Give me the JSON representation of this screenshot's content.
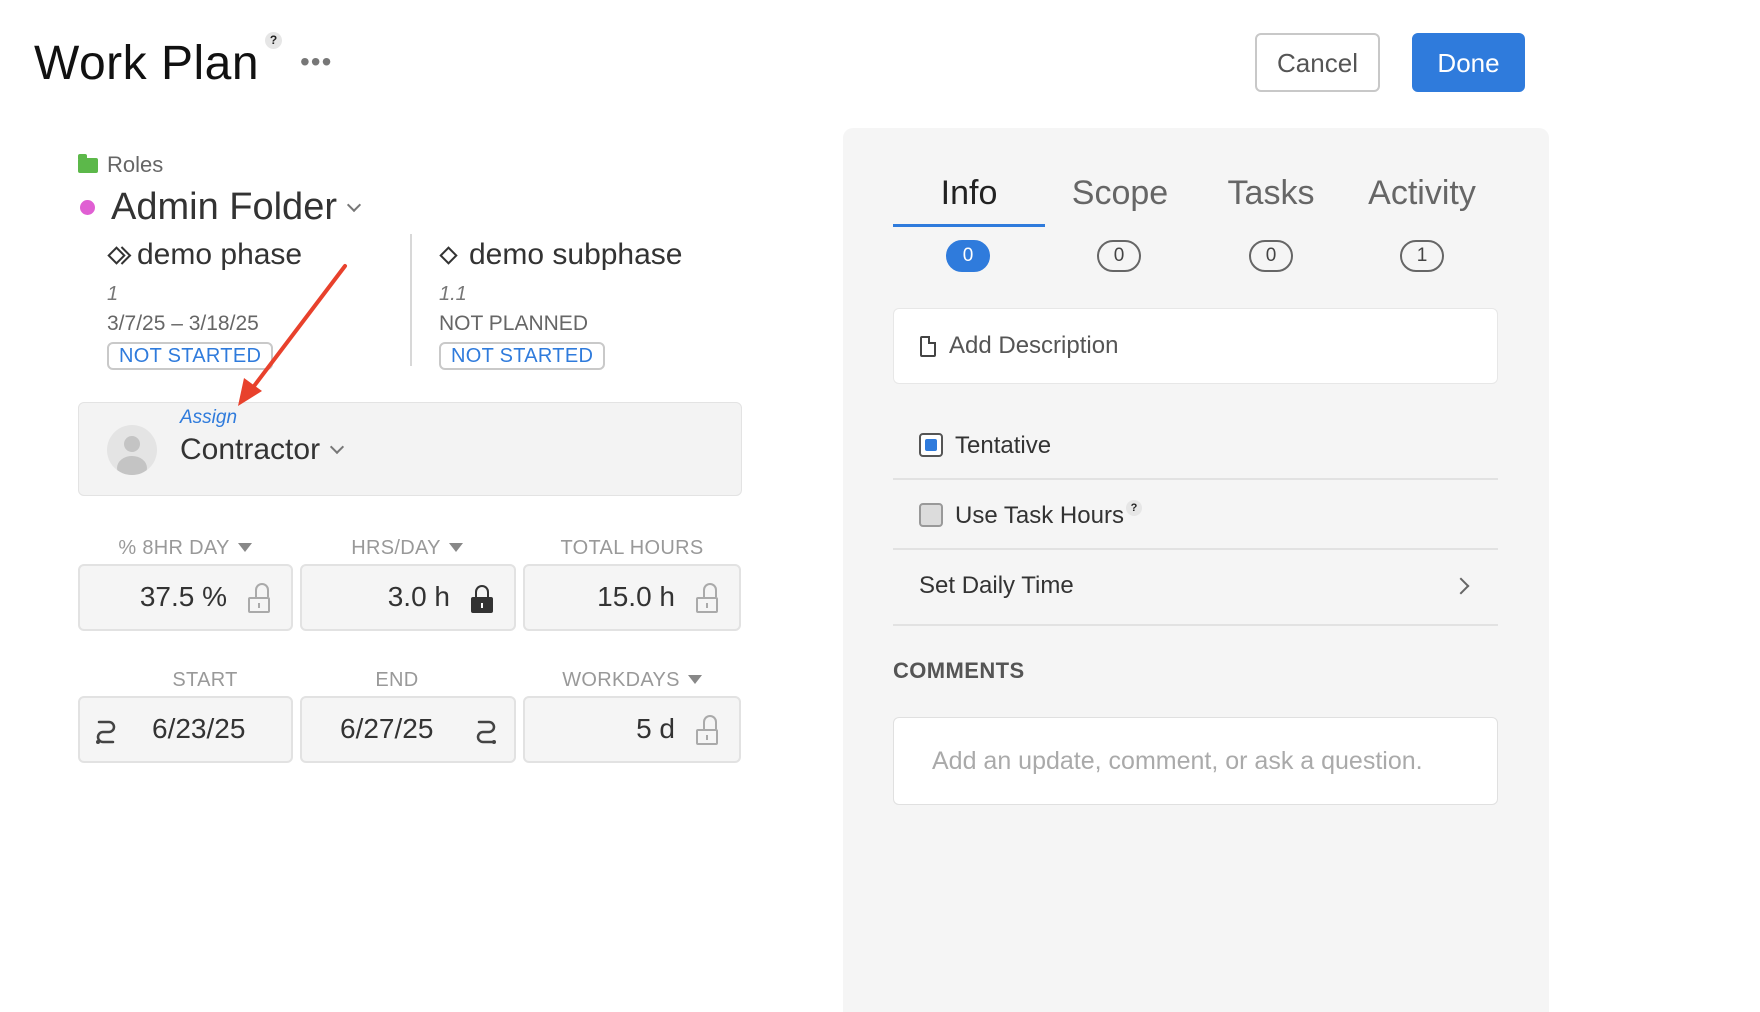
{
  "header": {
    "title": "Work Plan",
    "help_label": "?",
    "more_label": "•••",
    "cancel_label": "Cancel",
    "done_label": "Done"
  },
  "breadcrumb": {
    "folder_label": "Roles"
  },
  "project": {
    "name": "Admin Folder",
    "dot_color": "#e05fd3"
  },
  "phases": [
    {
      "name": "demo phase",
      "number": "1",
      "dates": "3/7/25 – 3/18/25",
      "status": "NOT STARTED"
    },
    {
      "name": "demo subphase",
      "number": "1.1",
      "dates": "NOT PLANNED",
      "status": "NOT STARTED"
    }
  ],
  "assign": {
    "label": "Assign",
    "value": "Contractor"
  },
  "fields": {
    "pct_day": {
      "label": "% 8HR DAY",
      "value": "37.5 %"
    },
    "hrs_day": {
      "label": "HRS/DAY",
      "value": "3.0 h"
    },
    "total_hours": {
      "label": "TOTAL HOURS",
      "value": "15.0 h"
    },
    "start": {
      "label": "START",
      "value": "6/23/25"
    },
    "end": {
      "label": "END",
      "value": "6/27/25"
    },
    "workdays": {
      "label": "WORKDAYS",
      "value": "5 d"
    }
  },
  "tabs": [
    {
      "label": "Info",
      "count": "0",
      "active": true
    },
    {
      "label": "Scope",
      "count": "0",
      "active": false
    },
    {
      "label": "Tasks",
      "count": "0",
      "active": false
    },
    {
      "label": "Activity",
      "count": "1",
      "active": false
    }
  ],
  "info": {
    "description_placeholder": "Add Description",
    "tentative_label": "Tentative",
    "tentative_checked": true,
    "use_task_hours_label": "Use Task Hours",
    "use_task_hours_checked": false,
    "set_daily_time_label": "Set Daily Time"
  },
  "comments": {
    "title": "COMMENTS",
    "placeholder": "Add an update, comment, or ask a question."
  },
  "colors": {
    "accent": "#2f7bdc",
    "folder": "#5cb84a",
    "annotation_arrow": "#e8412c"
  }
}
